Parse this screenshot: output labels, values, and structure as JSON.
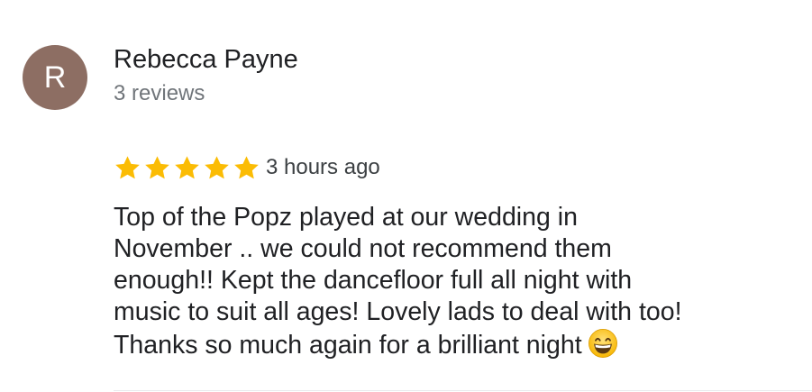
{
  "review": {
    "avatar_letter": "R",
    "avatar_color": "#8d6e63",
    "author_name": "Rebecca Payne",
    "review_count": "3 reviews",
    "rating": 5,
    "star_color": "#fbbc04",
    "time": "3 hours ago",
    "text_lines": [
      "Top of the Popz played at our wedding in",
      "November .. we could not recommend them",
      "enough!! Kept the dancefloor full all night with",
      "music to suit all ages! Lovely lads to deal with too!",
      "Thanks so much again for a brilliant night"
    ],
    "emoji": "grinning-face-with-smiling-eyes-icon"
  }
}
